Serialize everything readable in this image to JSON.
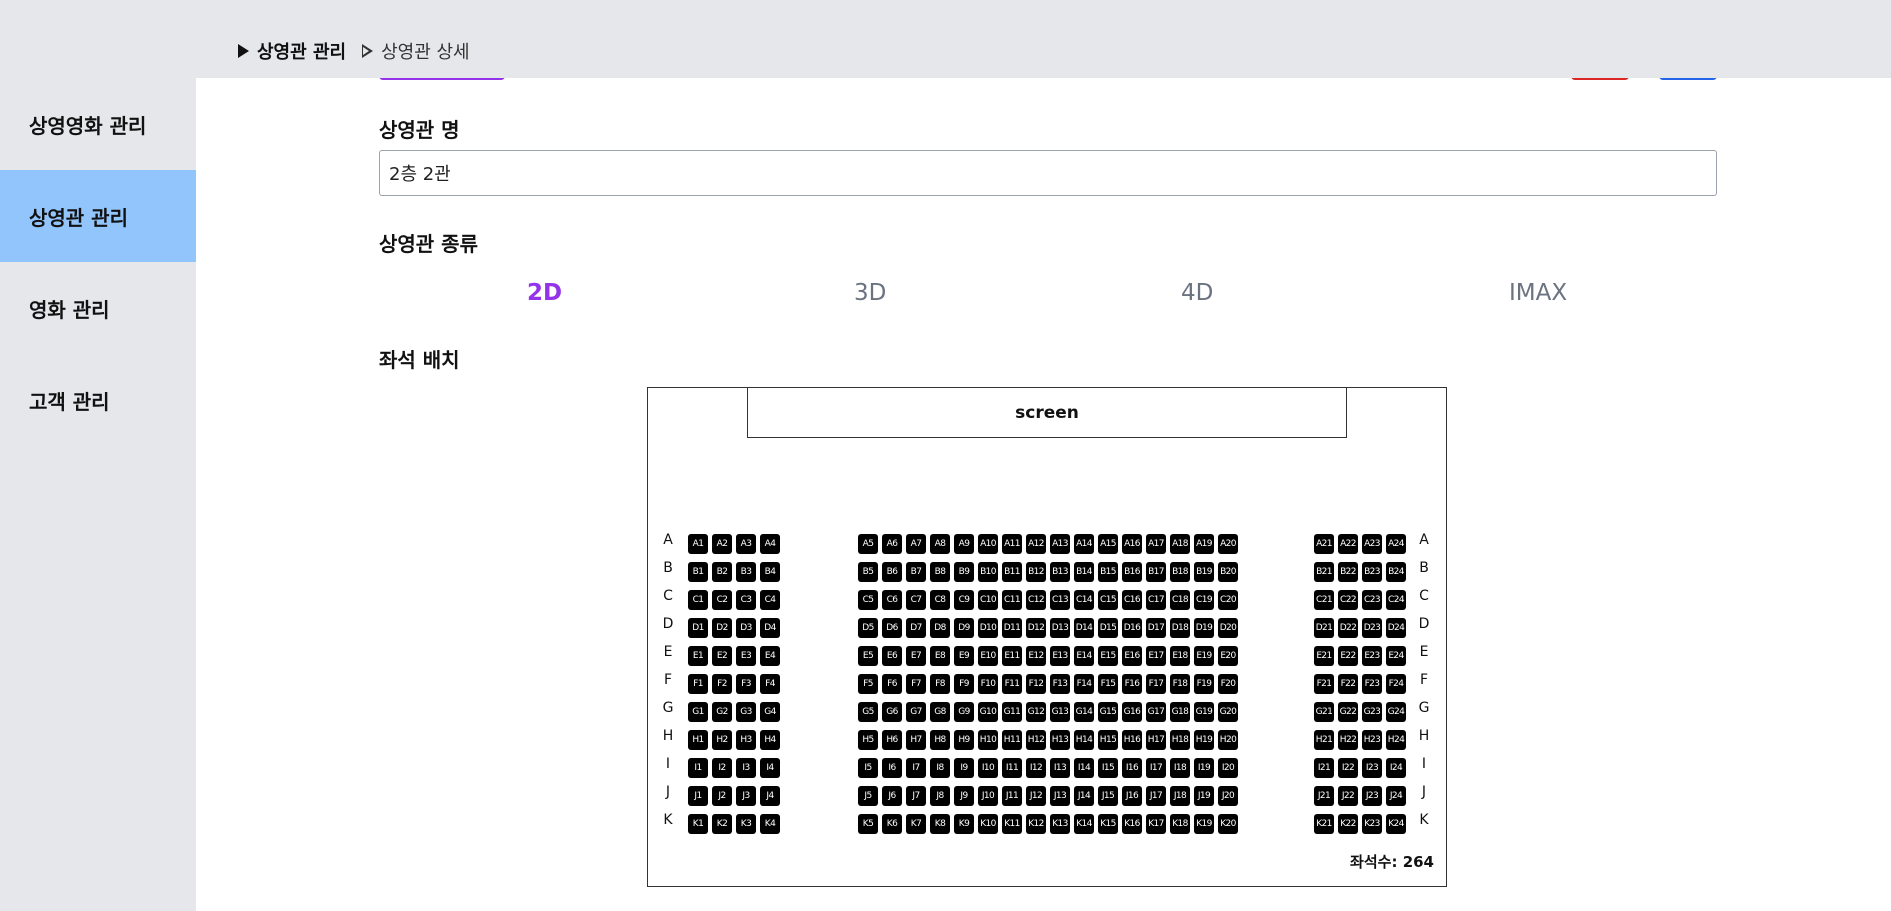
{
  "breadcrumb": {
    "current": "상영관 관리",
    "sub": "상영관 상세"
  },
  "sidebar": {
    "items": [
      {
        "label": "상영영화 관리",
        "active": false
      },
      {
        "label": "상영관 관리",
        "active": true
      },
      {
        "label": "영화 관리",
        "active": false
      },
      {
        "label": "고객 관리",
        "active": false
      }
    ]
  },
  "form": {
    "name_label": "상영관 명",
    "name_value": "2층 2관",
    "type_label": "상영관 종류",
    "types": [
      {
        "label": "2D",
        "selected": true
      },
      {
        "label": "3D",
        "selected": false
      },
      {
        "label": "4D",
        "selected": false
      },
      {
        "label": "IMAX",
        "selected": false
      }
    ],
    "seat_label": "좌석 배치"
  },
  "seat_map": {
    "screen_label": "screen",
    "rows": [
      "A",
      "B",
      "C",
      "D",
      "E",
      "F",
      "G",
      "H",
      "I",
      "J",
      "K"
    ],
    "blocks": [
      {
        "from": 1,
        "to": 4
      },
      {
        "from": 5,
        "to": 20
      },
      {
        "from": 21,
        "to": 24
      }
    ],
    "seat_count_label": "좌석수:",
    "seat_count": "264"
  },
  "colors": {
    "accent": "#9333ea",
    "active_nav": "#93c5fd",
    "seat": "#000000",
    "delete": "#dc2626",
    "save": "#2563eb"
  }
}
